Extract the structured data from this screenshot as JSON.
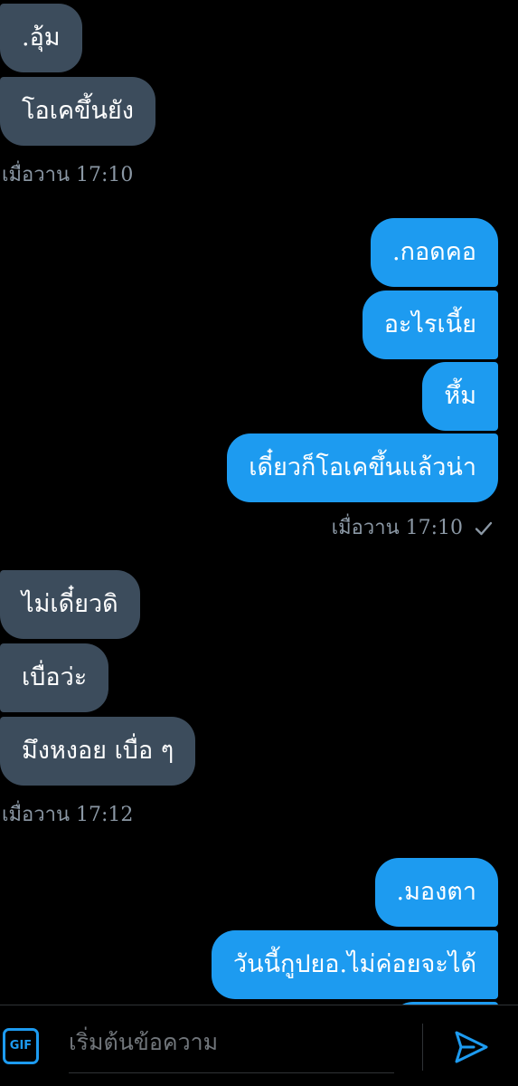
{
  "messages": [
    {
      "text": ".อุ้ม"
    },
    {
      "text": "โอเคขึ้นยัง"
    },
    {
      "text": ".กอดคอ"
    },
    {
      "text": "อะไรเนี้ย"
    },
    {
      "text": "หึ้ม"
    },
    {
      "text": "เดี๋ยวก็โอเคขึ้นแล้วน่า"
    },
    {
      "text": "ไม่เดี๋ยวดิ"
    },
    {
      "text": "เบื่อว่ะ"
    },
    {
      "text": "มึงหงอย เบื่อ ๆ"
    },
    {
      "text": ".มองตา"
    },
    {
      "text": "วันนี้กูปยอ.ไม่ค่อยจะได้"
    }
  ],
  "timestamps": [
    {
      "text": "เมื่อวาน  17:10"
    },
    {
      "text": "เมื่อวาน  17:10"
    },
    {
      "text": "เมื่อวาน  17:12"
    }
  ],
  "composer": {
    "gif_label": "GIF",
    "placeholder": "เริ่มต้นข้อความ",
    "value": ""
  },
  "icons": {
    "gif": "gif-icon",
    "send": "send-icon",
    "sent_check": "check-icon"
  },
  "colors": {
    "background": "#000000",
    "incoming_bubble": "#3c4c5c",
    "outgoing_bubble": "#1d9bf0",
    "timestamp": "#8b98a5",
    "accent": "#1d9bf0"
  }
}
